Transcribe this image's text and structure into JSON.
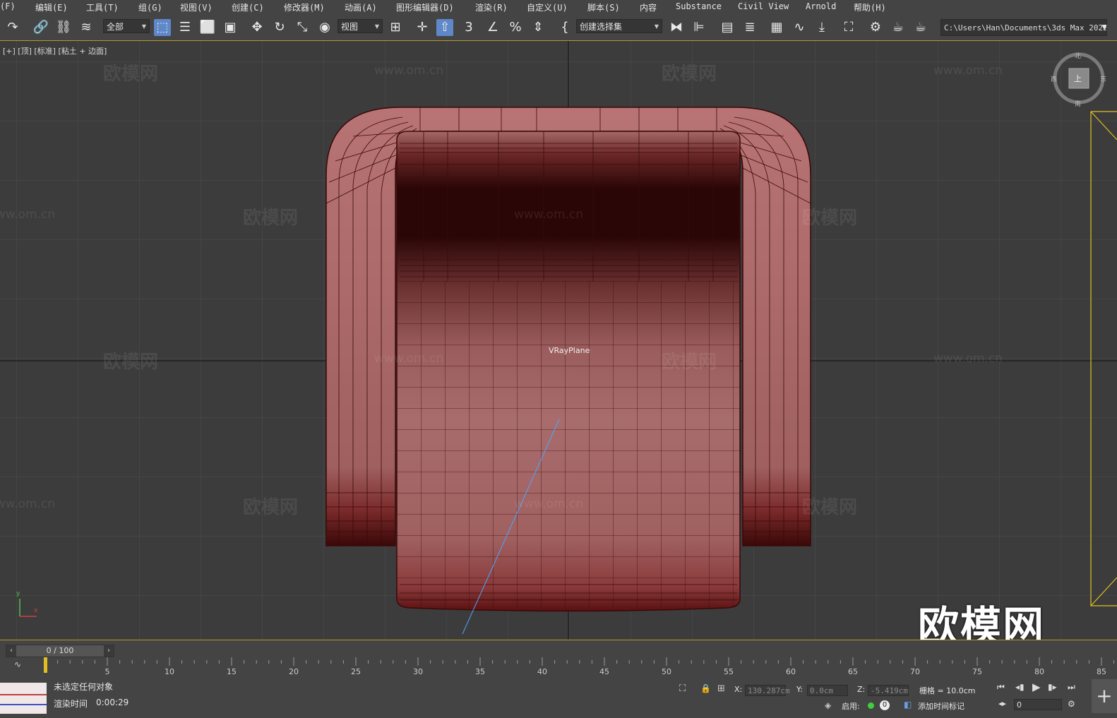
{
  "menu": [
    "(F)",
    "编辑(E)",
    "工具(T)",
    "组(G)",
    "视图(V)",
    "创建(C)",
    "修改器(M)",
    "动画(A)",
    "图形编辑器(D)",
    "渲染(R)",
    "自定义(U)",
    "脚本(S)",
    "内容",
    "Substance",
    "Civil View",
    "Arnold",
    "帮助(H)"
  ],
  "toolbar": {
    "selection_filter": "全部",
    "ref_coord": "视图",
    "named_selection": "创建选择集",
    "path": "C:\\Users\\Han\\Documents\\3ds Max 2022"
  },
  "viewport": {
    "label": "[+] [顶] [标准] [粘土 + 边面]",
    "object_label": "VRayPlane",
    "watermark_url": "www.om.cn",
    "watermark_cn": "欧模网",
    "viewcube_n": "北",
    "viewcube_s": "南",
    "viewcube_w": "西",
    "viewcube_e": "东",
    "viewcube_face": "上",
    "brand_logo": "欧模网",
    "axis_y": "y",
    "axis_x": "x"
  },
  "timeline": {
    "frame": "0 / 100",
    "ticks": [
      "5",
      "10",
      "15",
      "20",
      "25",
      "30",
      "35",
      "40",
      "45",
      "50",
      "55",
      "60",
      "65",
      "70",
      "75",
      "80",
      "85"
    ]
  },
  "status": {
    "selection_msg": "未选定任何对象",
    "render_label": "渲染时间",
    "render_time": "0:00:29",
    "x_label": "X:",
    "x_val": "130.287cm",
    "y_label": "Y:",
    "y_val": "0.0cm",
    "z_label": "Z:",
    "z_val": "-5.419cm",
    "grid": "栅格 = 10.0cm",
    "enable": "启用:",
    "enable_count": "0",
    "add_tag": "添加时间标记",
    "frame_field": "0"
  },
  "colors": {
    "accent": "#5e88c8",
    "sofa": "#a86868",
    "sofa_dark": "#2a0606",
    "timeline_border": "#b59a2a"
  }
}
